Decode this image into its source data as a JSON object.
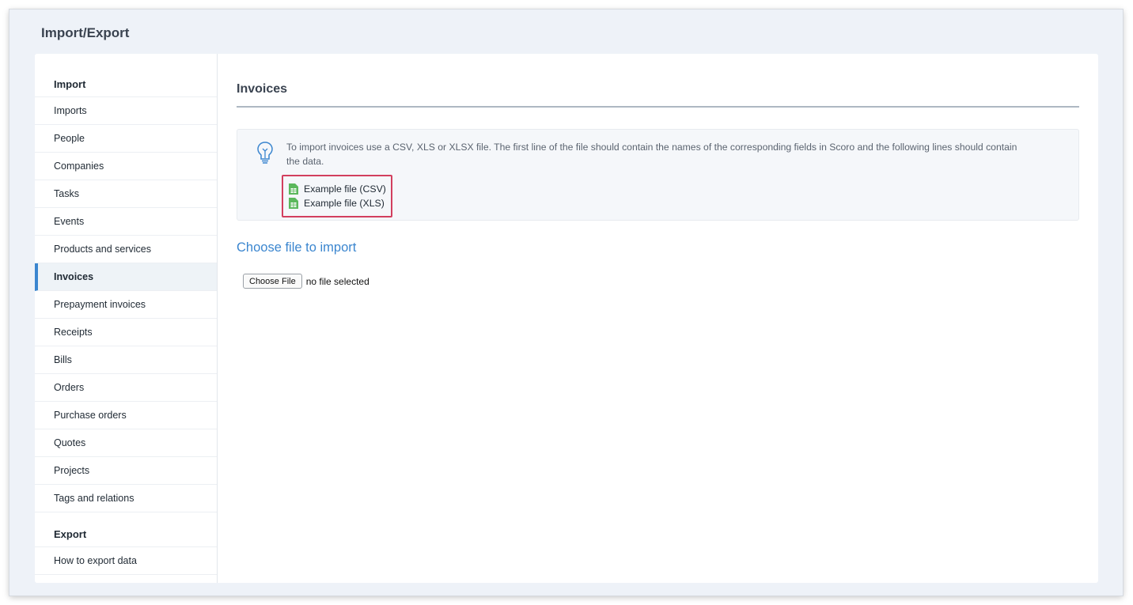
{
  "page": {
    "title": "Import/Export"
  },
  "sidebar": {
    "import_title": "Import",
    "import_items": [
      {
        "label": "Imports"
      },
      {
        "label": "People"
      },
      {
        "label": "Companies"
      },
      {
        "label": "Tasks"
      },
      {
        "label": "Events"
      },
      {
        "label": "Products and services"
      },
      {
        "label": "Invoices",
        "active": true
      },
      {
        "label": "Prepayment invoices"
      },
      {
        "label": "Receipts"
      },
      {
        "label": "Bills"
      },
      {
        "label": "Orders"
      },
      {
        "label": "Purchase orders"
      },
      {
        "label": "Quotes"
      },
      {
        "label": "Projects"
      },
      {
        "label": "Tags and relations"
      }
    ],
    "export_title": "Export",
    "export_items": [
      {
        "label": "How to export data"
      }
    ]
  },
  "main": {
    "section_title": "Invoices",
    "info": {
      "icon": "lightbulb-icon",
      "text": "To import invoices use a CSV, XLS or XLSX file. The first line of the file should contain the names of the corresponding fields in Scoro and the following lines should contain the data.",
      "examples": [
        {
          "label": "Example file (CSV)",
          "icon": "spreadsheet-icon"
        },
        {
          "label": "Example file (XLS)",
          "icon": "spreadsheet-icon"
        }
      ]
    },
    "choose_title": "Choose file to import",
    "file_input": {
      "button_label": "Choose File",
      "status": "no file selected"
    }
  },
  "colors": {
    "accent": "#3b86cf",
    "highlight_border": "#d23f5e",
    "spreadsheet_icon": "#5cb85c"
  }
}
